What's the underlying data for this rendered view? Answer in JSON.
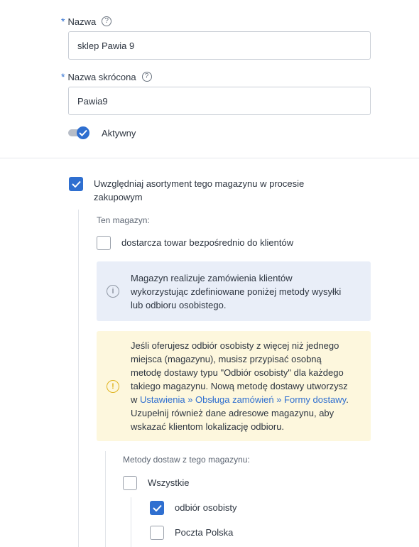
{
  "name_field": {
    "label": "Nazwa",
    "value": "sklep Pawia 9",
    "help": "?"
  },
  "short_name_field": {
    "label": "Nazwa skrócona",
    "value": "Pawia9",
    "help": "?"
  },
  "active_toggle": {
    "label": "Aktywny",
    "on": true
  },
  "include_stock": {
    "label_line1": "Uwzględniaj asortyment tego magazynu w procesie",
    "label_line2": "zakupowym",
    "checked": true
  },
  "this_warehouse": {
    "heading": "Ten magazyn:"
  },
  "delivers_direct": {
    "label": "dostarcza towar bezpośrednio do klientów",
    "checked": false
  },
  "info_box": {
    "icon": "i",
    "lines": [
      "Magazyn realizuje zamówienia klientów",
      "wykorzystując zdefiniowane poniżej metody wysyłki",
      "lub odbioru osobistego."
    ]
  },
  "warn_box": {
    "icon": "!",
    "line1": "Jeśli oferujesz odbiór osobisty z więcej niż jednego",
    "line2": "miejsca (magazynu), musisz przypisać osobną",
    "line3": "metodę dostawy typu \"Odbiór osobisty\" dla każdego",
    "line4": "takiego magazynu. Nową metodę dostawy utworzysz",
    "line5_prefix": "w ",
    "link": "Ustawienia » Obsługa zamówień » Formy dostawy",
    "line5_suffix": ".",
    "line6": "Uzupełnij również dane adresowe magazynu, aby",
    "line7": "wskazać klientom lokalizację odbioru."
  },
  "delivery_methods": {
    "heading": "Metody dostaw z tego magazynu:",
    "all": {
      "label": "Wszystkie",
      "checked": false
    },
    "items": [
      {
        "label": "odbiór osobisty",
        "checked": true
      },
      {
        "label": "Poczta Polska",
        "checked": false
      }
    ]
  },
  "colors": {
    "accent": "#2f6fd0",
    "info_bg": "#e9eef8",
    "warn_bg": "#fdf7dd",
    "warn_icon": "#e0b420"
  }
}
